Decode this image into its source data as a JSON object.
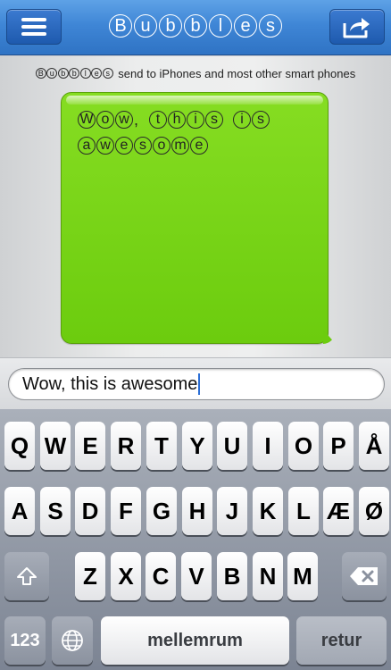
{
  "topbar": {
    "menu_icon": "hamburger-menu-icon",
    "share_icon": "share-arrow-icon",
    "title_letters": [
      "B",
      "u",
      "b",
      "b",
      "l",
      "e",
      "s"
    ]
  },
  "subtitle": {
    "brand_letters": [
      "B",
      "u",
      "b",
      "b",
      "l",
      "e",
      "s"
    ],
    "text": "send to iPhones and most other smart phones"
  },
  "bubble": {
    "color": "#6ccc0e",
    "words": [
      {
        "chars": [
          "W",
          "o",
          "w"
        ],
        "punct": ","
      },
      {
        "chars": [
          "t",
          "h",
          "i",
          "s"
        ],
        "punct": ""
      },
      {
        "chars": [
          "i",
          "s"
        ],
        "punct": ""
      },
      {
        "chars": [
          "a",
          "w",
          "e",
          "s",
          "o",
          "m",
          "e"
        ],
        "punct": ""
      }
    ]
  },
  "input": {
    "value": "Wow, this is awesome"
  },
  "keyboard": {
    "row1": [
      "Q",
      "W",
      "E",
      "R",
      "T",
      "Y",
      "U",
      "I",
      "O",
      "P",
      "Å"
    ],
    "row2": [
      "A",
      "S",
      "D",
      "F",
      "G",
      "H",
      "J",
      "K",
      "L",
      "Æ",
      "Ø"
    ],
    "row3": [
      "Z",
      "X",
      "C",
      "V",
      "B",
      "N",
      "M"
    ],
    "shift_icon": "shift-arrow-icon",
    "backspace_icon": "backspace-icon",
    "numbers_label": "123",
    "globe_icon": "globe-icon",
    "space_label": "mellemrum",
    "return_label": "retur"
  }
}
